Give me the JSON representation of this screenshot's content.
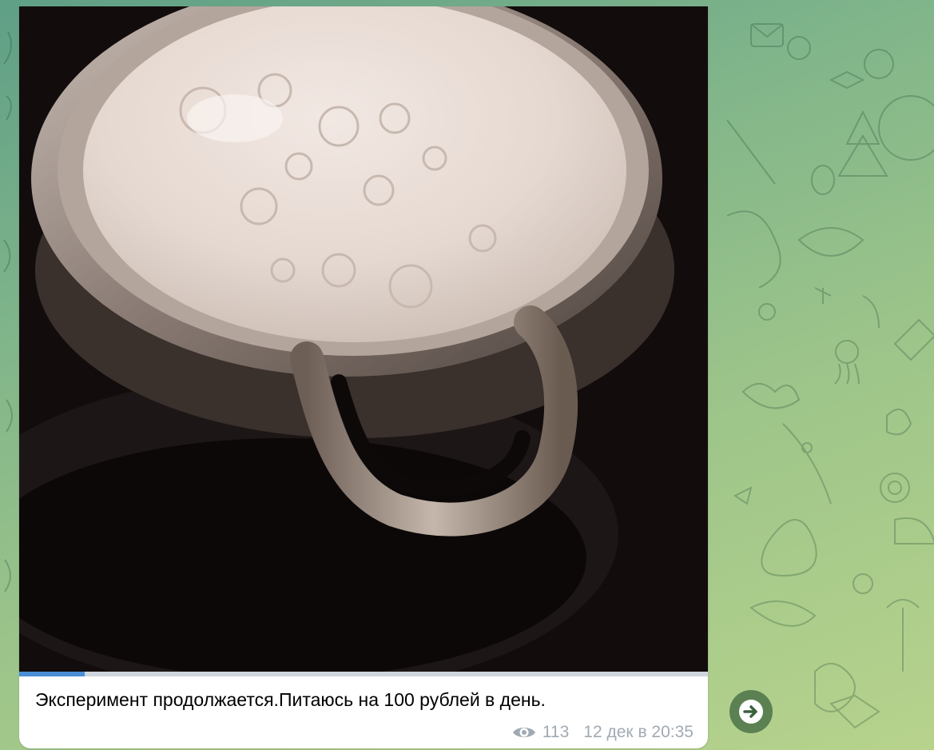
{
  "message": {
    "caption": "Эксперимент продолжается.Питаюсь на 100 рублей в день.",
    "views": "113",
    "timestamp": "12 дек в 20:35",
    "media_progress": 0.095,
    "media_description": "pot-with-boiling-milk-photo"
  },
  "icons": {
    "views": "eye-icon",
    "forward": "forward-arrow-icon"
  },
  "colors": {
    "accent": "#4a8fd6",
    "meta_text": "#a1aab3",
    "bubble": "#ffffff"
  }
}
